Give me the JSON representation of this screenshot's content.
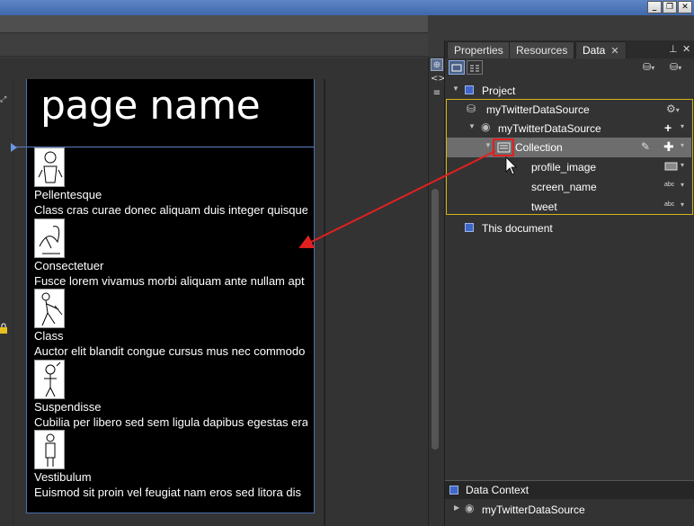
{
  "window": {
    "buttons": {
      "minimize": "_",
      "restore": "❐",
      "close": "✕"
    }
  },
  "artboard": {
    "page_title": "page name",
    "items": [
      {
        "name": "Pellentesque",
        "text": "Class cras curae donec aliquam duis integer quisque"
      },
      {
        "name": "Consectetuer",
        "text": "Fusce lorem vivamus morbi aliquam ante nullam apt"
      },
      {
        "name": "Class",
        "text": "Auctor elit blandit congue cursus mus nec commodo"
      },
      {
        "name": "Suspendisse",
        "text": "Cubilia per libero sed sem ligula dapibus egestas era"
      },
      {
        "name": "Vestibulum",
        "text": "Euismod sit proin vel feugiat nam eros sed litora dis"
      }
    ]
  },
  "panel": {
    "tabs": [
      {
        "label": "Properties",
        "active": false
      },
      {
        "label": "Resources",
        "active": false
      },
      {
        "label": "Data",
        "active": true,
        "close": "✕"
      }
    ],
    "pin": "📌",
    "tree": {
      "project": "Project",
      "datasource_root": "myTwitterDataSource",
      "datasource_child": "myTwitterDataSource",
      "collection": "Collection",
      "fields": [
        "profile_image",
        "screen_name",
        "tweet"
      ],
      "field_types": [
        "image",
        "abc",
        "abc"
      ],
      "this_document": "This document",
      "add": "+"
    },
    "data_context": {
      "header": "Data Context",
      "item": "myTwitterDataSource"
    }
  },
  "colors": {
    "accent_blue": "#3f67c9",
    "selection_yellow": "#d4b31c",
    "highlight_red": "#e02020"
  }
}
